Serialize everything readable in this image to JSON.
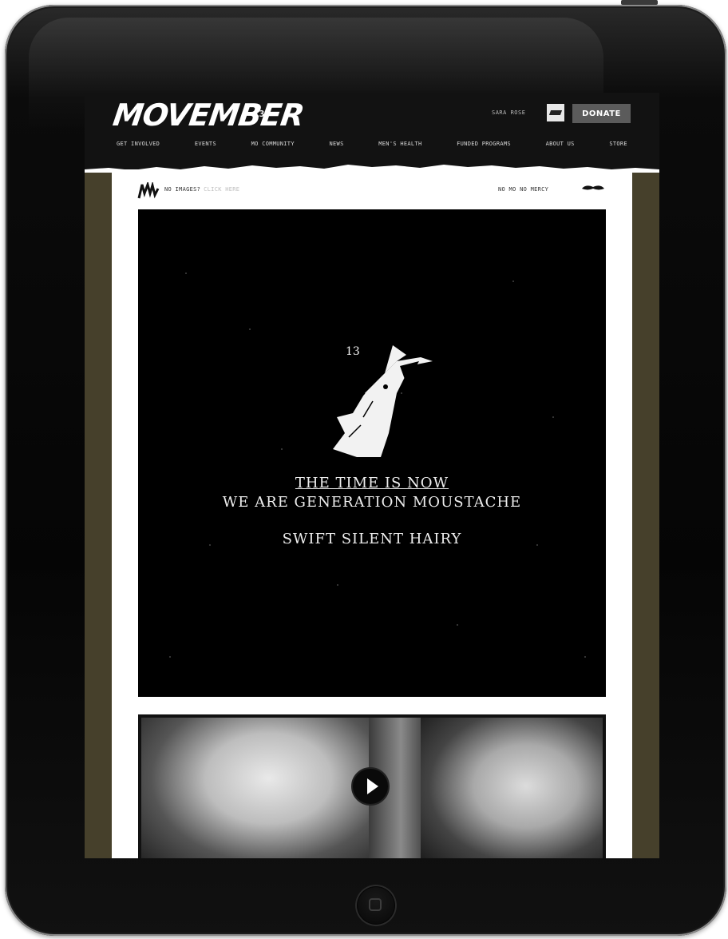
{
  "header": {
    "logo_text": "MOVEMBER",
    "logo_mark": "13",
    "user_name": "SARA ROSE",
    "donate_label": "DONATE",
    "nav": [
      "GET INVOLVED",
      "EVENTS",
      "MO COMMUNITY",
      "NEWS",
      "MEN'S HEALTH",
      "FUNDED PROGRAMS",
      "ABOUT US",
      "STORE"
    ]
  },
  "email": {
    "no_images_text": "NO IMAGES?",
    "click_here": "CLICK HERE",
    "mo_mercy": "NO MO NO MERCY",
    "hero": {
      "line1": "THE TIME IS NOW",
      "line2": "WE ARE GENERATION MOUSTACHE",
      "line3": "SWIFT SILENT HAIRY"
    }
  },
  "colors": {
    "header_bg": "#121212",
    "page_bg": "#46402b",
    "hero_bg": "#000000",
    "donate_bg": "#5b5b5b"
  },
  "icons": [
    "movember-logo-icon",
    "avatar-icon",
    "mo-brand-icon",
    "moustache-icon",
    "wolf-illustration",
    "play-icon",
    "home-button-icon"
  ]
}
